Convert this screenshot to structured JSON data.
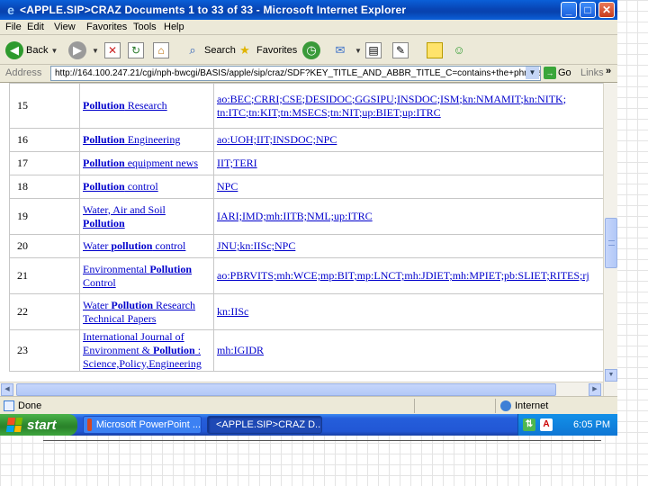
{
  "window": {
    "title": "<APPLE.SIP>CRAZ Documents 1 to 33 of 33 - Microsoft Internet Explorer",
    "controls": {
      "minimize": "_",
      "maximize": "□",
      "close": "✕"
    }
  },
  "menu": [
    "File",
    "Edit",
    "View",
    "Favorites",
    "Tools",
    "Help"
  ],
  "toolbar": {
    "back": "Back",
    "search": "Search",
    "favorites": "Favorites"
  },
  "address": {
    "label": "Address",
    "url": "http://164.100.247.21/cgi/nph-bwcgi/BASIS/apple/sip/craz/SDF?KEY_TITLE_AND_ABBR_TITLE_C=contains+the+phrase&KE",
    "go": "Go",
    "links": "Links",
    "more": "»"
  },
  "rows": [
    {
      "num": "15",
      "title": [
        {
          "t": "Pollution",
          "b": true,
          "link": true
        },
        {
          "t": " Research",
          "link": true
        }
      ],
      "codes": [
        "ao:BEC;CRRI;CSE;DESIDOC;GGSIPU;INSDOC;ISM;kn:NMAMIT;kn:NITK;",
        "tn:ITC;tn:KIT;tn:MSECS;tn:NIT;up:BIET;up:ITRC"
      ]
    },
    {
      "num": "16",
      "title": [
        {
          "t": "Pollution",
          "b": true,
          "link": true
        },
        {
          "t": " Engineering",
          "link": true
        }
      ],
      "codes": [
        "ao:UOH;IIT;INSDOC;NPC"
      ]
    },
    {
      "num": "17",
      "title": [
        {
          "t": "Pollution",
          "b": true,
          "link": true
        },
        {
          "t": " equipment news",
          "link": true
        }
      ],
      "codes": [
        "IIT;TERI"
      ]
    },
    {
      "num": "18",
      "title": [
        {
          "t": "Pollution",
          "b": true,
          "link": true
        },
        {
          "t": " control",
          "link": true
        }
      ],
      "codes": [
        "NPC"
      ]
    },
    {
      "num": "19",
      "title": [
        {
          "t": "Water, Air and Soil",
          "link": true
        },
        {
          "br": true
        },
        {
          "t": "Pollution",
          "b": true,
          "link": true
        }
      ],
      "codes": [
        "IARI;IMD;mh:IITB;NML;up:ITRC"
      ]
    },
    {
      "num": "20",
      "title": [
        {
          "t": "Water ",
          "link": true
        },
        {
          "t": "pollution",
          "b": true,
          "link": true
        },
        {
          "t": " control",
          "link": true
        }
      ],
      "codes": [
        "JNU;kn:IISc;NPC"
      ]
    },
    {
      "num": "21",
      "title": [
        {
          "t": "Environmental ",
          "link": true
        },
        {
          "t": "Pollution",
          "b": true,
          "link": true
        },
        {
          "br": true
        },
        {
          "t": "Control",
          "link": true
        }
      ],
      "codes": [
        "ao:PBRVITS;mh:WCE;mp:BIT;mp:LNCT;mh:JDIET;mh:MPIET;pb:SLIET;RITES;rj"
      ]
    },
    {
      "num": "22",
      "title": [
        {
          "t": "Water ",
          "link": true
        },
        {
          "t": "Pollution",
          "b": true,
          "link": true
        },
        {
          "t": " Research",
          "link": true
        },
        {
          "br": true
        },
        {
          "t": "Technical Papers",
          "link": true
        }
      ],
      "codes": [
        "kn:IISc"
      ]
    },
    {
      "num": "23",
      "title": [
        {
          "t": "International Journal of",
          "link": true
        },
        {
          "br": true
        },
        {
          "t": "Environment & ",
          "link": true
        },
        {
          "t": "Pollution",
          "b": true,
          "link": true
        },
        {
          "t": " :",
          "link": true
        },
        {
          "br": true
        },
        {
          "t": "Science,Policy,Engineering",
          "link": true
        }
      ],
      "codes": [
        "mh:IGIDR"
      ]
    }
  ],
  "status": {
    "text": "Done",
    "zone": "Internet"
  },
  "taskbar": {
    "start": "start",
    "items": [
      {
        "label": "Microsoft PowerPoint ...",
        "active": false
      },
      {
        "label": "<APPLE.SIP>CRAZ D...",
        "active": true
      }
    ],
    "clock": "6:05 PM"
  },
  "colors": {
    "titlebar": "#0a5fd8",
    "link": "#0000cc",
    "taskbar": "#245edb",
    "start": "#2f8c2f"
  }
}
